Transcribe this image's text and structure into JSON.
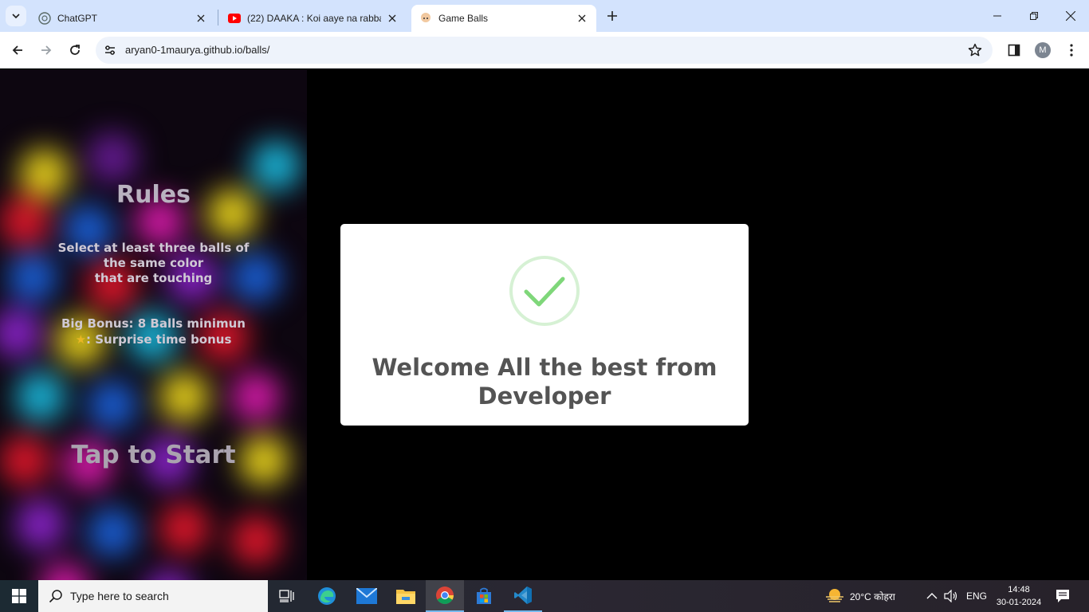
{
  "browser": {
    "tabs": [
      {
        "title": "ChatGPT",
        "icon": "chatgpt-icon",
        "active": false
      },
      {
        "title": "(22) DAAKA : Koi aaye na rabba",
        "icon": "youtube-icon",
        "active": false
      },
      {
        "title": "Game Balls",
        "icon": "game-favicon",
        "active": true
      }
    ],
    "url": "aryan0-1maurya.github.io/balls/",
    "profile_initial": "M"
  },
  "game": {
    "rules_title": "Rules",
    "rule_line_1": "Select at least three balls of",
    "rule_line_2": "the same color",
    "rule_line_3": "that are touching",
    "bonus_line_1": "Big Bonus: 8 Balls minimun",
    "bonus_star": "★",
    "bonus_line_2": ": Surprise time bonus",
    "tap_to_start": "Tap to Start",
    "ball_colors": [
      "#e8d21c",
      "#1a5fd6",
      "#e0162a",
      "#8a23c9",
      "#1ab6d9",
      "#d61aa8"
    ]
  },
  "modal": {
    "line_1": "Welcome All the best from",
    "line_2": "Developer",
    "check_color": "#7fd77a"
  },
  "taskbar": {
    "search_placeholder": "Type here to search",
    "weather": "20°C  कोहरा",
    "language": "ENG",
    "time": "14:48",
    "date": "30-01-2024"
  }
}
